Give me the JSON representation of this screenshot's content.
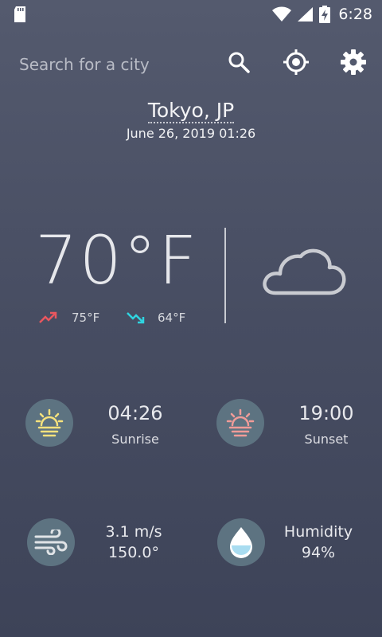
{
  "status_bar": {
    "time": "6:28",
    "icons": [
      "sd-card-icon",
      "wifi-icon",
      "cell-signal-icon",
      "battery-charging-icon"
    ]
  },
  "search": {
    "placeholder": "Search for a city"
  },
  "toolbar": {
    "icons": [
      "search-icon",
      "locate-icon",
      "settings-icon"
    ]
  },
  "location": {
    "city": "Tokyo, JP",
    "datetime": "June 26, 2019 01:26"
  },
  "current": {
    "temperature": "70°F",
    "high": "75°F",
    "low": "64°F",
    "condition_icon": "cloud-icon"
  },
  "details": {
    "sunrise_time": "04:26",
    "sunrise_label": "Sunrise",
    "sunset_time": "19:00",
    "sunset_label": "Sunset",
    "wind_speed": "3.1 m/s",
    "wind_direction": "150.0°",
    "humidity_label": "Humidity",
    "humidity_value": "94%"
  },
  "colors": {
    "background": "#4a5064",
    "high_arrow": "#e8575f",
    "low_arrow": "#2fd4e0",
    "sunrise_icon": "#f6e27c",
    "sunset_icon": "#f09b98",
    "circle_bg": "#5d7381",
    "water_drop": "#a8dcf0"
  }
}
